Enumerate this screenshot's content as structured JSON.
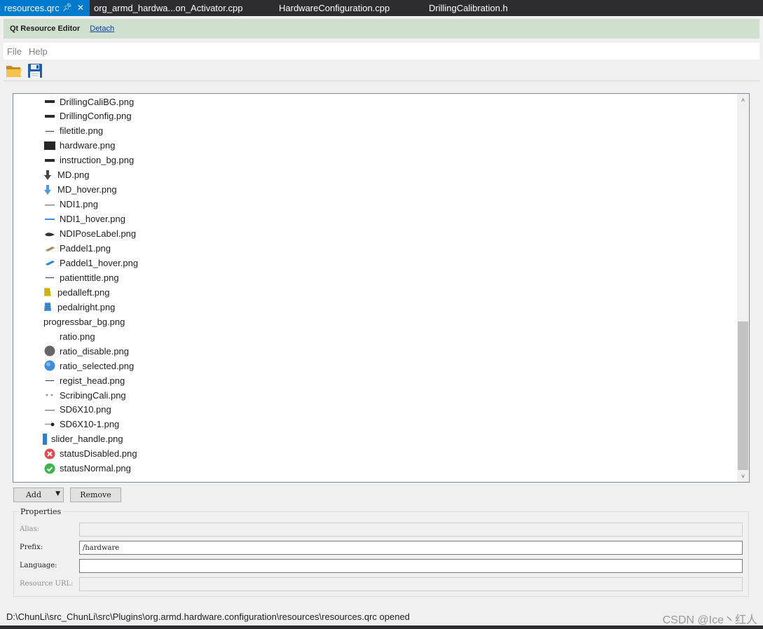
{
  "tabs": [
    {
      "label": "resources.qrc",
      "active": true
    },
    {
      "label": "org_armd_hardwa...on_Activator.cpp",
      "active": false
    },
    {
      "label": "HardwareConfiguration.cpp",
      "active": false
    },
    {
      "label": "DrillingCalibration.h",
      "active": false
    }
  ],
  "infobar": {
    "title": "Qt Resource Editor",
    "detach_label": "Detach"
  },
  "menu": {
    "file": "File",
    "help": "Help"
  },
  "toolbar": {
    "open_icon": "folder-open-icon",
    "save_icon": "floppy-save-icon"
  },
  "files": [
    {
      "name": "DrillingCaliBG.png",
      "icon": "dark-bar"
    },
    {
      "name": "DrillingConfig.png",
      "icon": "dark-bar"
    },
    {
      "name": "filetitle.png",
      "icon": "thin-line"
    },
    {
      "name": "hardware.png",
      "icon": "dark-rect"
    },
    {
      "name": "instruction_bg.png",
      "icon": "dark-bar"
    },
    {
      "name": "MD.png",
      "icon": "arrow-down-dark"
    },
    {
      "name": "MD_hover.png",
      "icon": "arrow-down-blue"
    },
    {
      "name": "NDI1.png",
      "icon": "gray-line"
    },
    {
      "name": "NDI1_hover.png",
      "icon": "blue-line"
    },
    {
      "name": "NDIPoseLabel.png",
      "icon": "dark-tool"
    },
    {
      "name": "Paddel1.png",
      "icon": "paddle-gold"
    },
    {
      "name": "Paddel1_hover.png",
      "icon": "paddle-blue"
    },
    {
      "name": "patienttitle.png",
      "icon": "thin-line"
    },
    {
      "name": "pedalleft.png",
      "icon": "pedal-yellow"
    },
    {
      "name": "pedalright.png",
      "icon": "pedal-blue"
    },
    {
      "name": "progressbar_bg.png",
      "icon": "none"
    },
    {
      "name": "ratio.png",
      "icon": "blank"
    },
    {
      "name": "ratio_disable.png",
      "icon": "circle-gray"
    },
    {
      "name": "ratio_selected.png",
      "icon": "circle-blue"
    },
    {
      "name": "regist_head.png",
      "icon": "thin-line"
    },
    {
      "name": "ScribingCali.png",
      "icon": "dots"
    },
    {
      "name": "SD6X10.png",
      "icon": "gray-line"
    },
    {
      "name": "SD6X10-1.png",
      "icon": "dot-dark"
    },
    {
      "name": "slider_handle.png",
      "icon": "blue-handle"
    },
    {
      "name": "statusDisabled.png",
      "icon": "x-circle-red"
    },
    {
      "name": "statusNormal.png",
      "icon": "check-circle-green"
    }
  ],
  "buttons": {
    "add": "Add",
    "remove": "Remove"
  },
  "properties": {
    "legend": "Properties",
    "alias_label": "Alias:",
    "alias_value": "",
    "prefix_label": "Prefix:",
    "prefix_value": "/hardware",
    "language_label": "Language:",
    "language_value": "",
    "url_label": "Resource URL:",
    "url_value": ""
  },
  "status": "D:\\ChunLi\\src_ChunLi\\src\\Plugins\\org.armd.hardware.configuration\\resources\\resources.qrc opened",
  "watermark": "CSDN @Ice丶红人",
  "colors": {
    "accent": "#007acc",
    "infobar": "#cfe0cf",
    "tabstrip": "#2d2d30"
  }
}
